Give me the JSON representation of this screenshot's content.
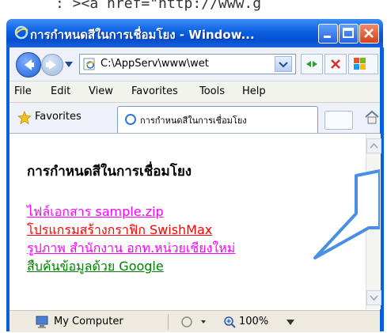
{
  "background_code": ": ><a href=\"http://www.g",
  "window": {
    "title": "การกำหนดสีในการเชื่อมโยง - Window..."
  },
  "address_bar": {
    "url": "C:\\AppServ\\www\\wet"
  },
  "menu": {
    "items": [
      "File",
      "Edit",
      "View",
      "Favorites",
      "Tools",
      "Help"
    ]
  },
  "favorites_bar": {
    "favorites_label": "Favorites",
    "tab_title": "การกำหนดสีในการเชื่อมโยง"
  },
  "page": {
    "heading": "การกำหนดสีในการเชื่อมโยง",
    "links": [
      {
        "text": "ไฟล์เอกสาร sample.zip",
        "color": "#ff00ff"
      },
      {
        "text": "โปรแกรมสร้างกราฟิก SwishMax",
        "color": "#ff0000"
      },
      {
        "text": "รูปภาพ สำนักงาน อกท.หน่วยเชียงใหม่",
        "color": "#ff00ff"
      },
      {
        "text": "สืบค้นข้อมูลด้วย Google",
        "color": "#008000"
      }
    ]
  },
  "status_bar": {
    "zone": "My Computer",
    "zoom": "100%"
  },
  "colors": {
    "titlebar": "#0a5fe0",
    "callout": "#4a90e2"
  }
}
